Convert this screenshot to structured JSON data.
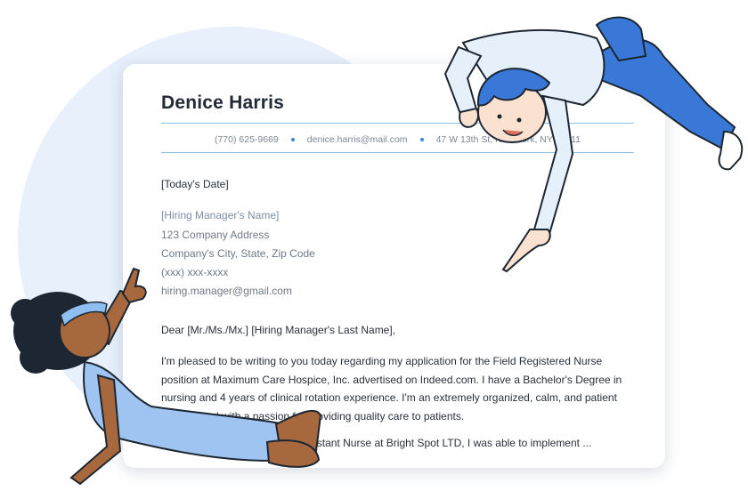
{
  "letter": {
    "name": "Denice Harris",
    "contact": {
      "phone": "(770) 625-9669",
      "email": "denice.harris@mail.com",
      "address": "47 W 13th St, New York, NY 10011"
    },
    "date": "[Today's Date]",
    "recipient": {
      "manager_name": "[Hiring Manager's Name]",
      "company_address": "123 Company Address",
      "city_state_zip": "Company's City, State, Zip Code",
      "phone": "(xxx) xxx-xxxx",
      "email": "hiring.manager@gmail.com"
    },
    "salutation": "Dear [Mr./Ms./Mx.] [Hiring Manager's Last Name],",
    "paragraph1": "I'm pleased to be writing to you today regarding my application for the Field Registered Nurse position at Maximum Care Hospice, Inc. advertised on Indeed.com. I have a Bachelor's Degree in nursing and 4 years of clinical rotation experience. I'm an extremely organized, calm, and patient professional with a passion for providing quality care to patients.",
    "paragraph2": "During my experience as an Assistant Nurse at Bright Spot LTD, I was able to implement ..."
  },
  "colors": {
    "accent": "#3f86d4",
    "rule": "#8cc3ec",
    "background_circle": "#e7f0fb",
    "figure_blue": "#3a78d8",
    "skin_dark": "#a7683e"
  },
  "icons": {
    "illustration_man": "cartoon-man-pointing",
    "illustration_woman": "cartoon-woman-pointing"
  }
}
